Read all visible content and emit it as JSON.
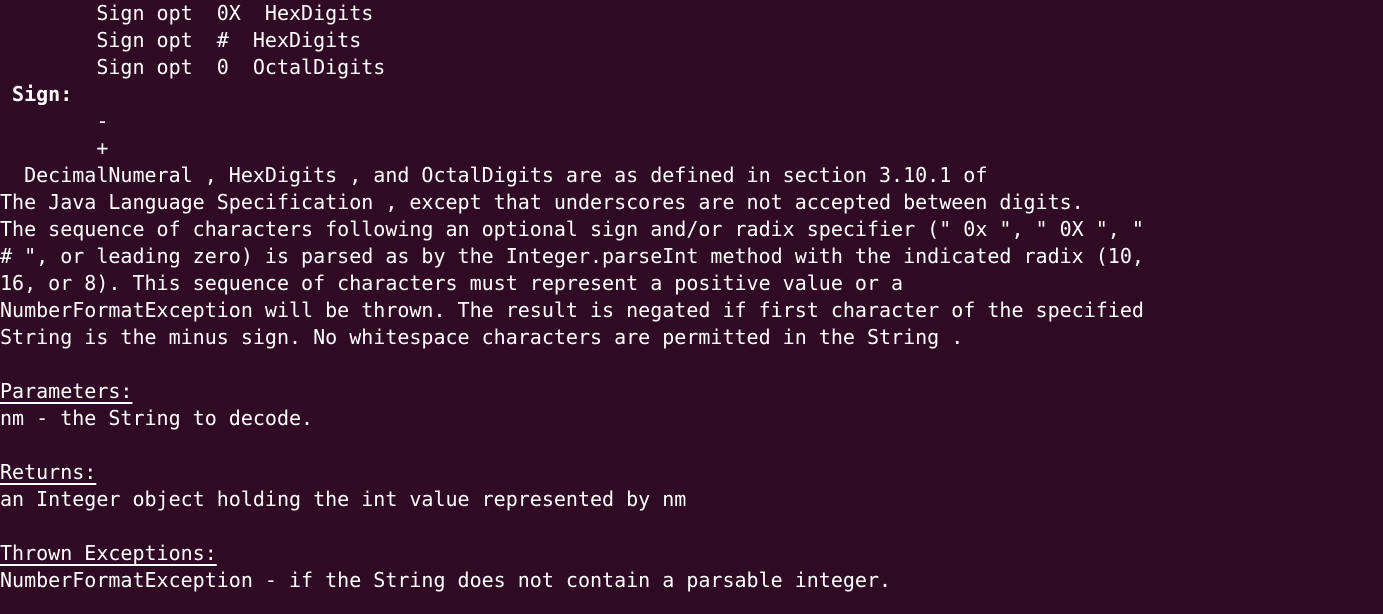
{
  "terminal": {
    "background": "#300a24",
    "foreground": "#ffffff",
    "lines": [
      "        Sign opt  0X  HexDigits",
      "        Sign opt  #  HexDigits",
      "        Sign opt  0  OctalDigits",
      " Sign:",
      "        -",
      "        +",
      "  DecimalNumeral , HexDigits , and OctalDigits are as defined in section 3.10.1 of",
      "The Java Language Specification , except that underscores are not accepted between digits.",
      "The sequence of characters following an optional sign and/or radix specifier (\" 0x \", \" 0X \", \"",
      "# \", or leading zero) is parsed as by the Integer.parseInt method with the indicated radix (10,",
      "16, or 8). This sequence of characters must represent a positive value or a",
      "NumberFormatException will be thrown. The result is negated if first character of the specified",
      "String is the minus sign. No whitespace characters are permitted in the String .",
      "",
      "Parameters:",
      "nm - the String to decode.",
      "",
      "Returns:",
      "an Integer object holding the int value represented by nm",
      "",
      "Thrown Exceptions:",
      "NumberFormatException - if the String does not contain a parsable integer."
    ]
  }
}
